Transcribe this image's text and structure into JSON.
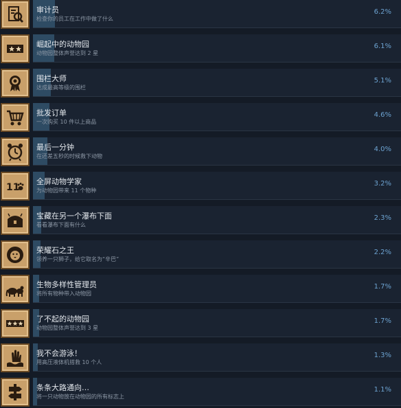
{
  "achievements": [
    {
      "title": "审计员",
      "desc": "检查你的员工在工作中做了什么",
      "percent": "6.2%",
      "fill": 0.062,
      "icon": "clipboard-search-icon"
    },
    {
      "title": "崛起中的动物园",
      "desc": "动物园整体声誉达到 2 星",
      "percent": "6.1%",
      "fill": 0.061,
      "icon": "two-stars-icon"
    },
    {
      "title": "围栏大师",
      "desc": "达成最高等级的围栏",
      "percent": "5.1%",
      "fill": 0.051,
      "icon": "award-ribbon-icon"
    },
    {
      "title": "批发订单",
      "desc": "一次购买 10 件以上商品",
      "percent": "4.6%",
      "fill": 0.046,
      "icon": "shopping-cart-icon"
    },
    {
      "title": "最后一分钟",
      "desc": "在还差五秒的时候救下动物",
      "percent": "4.0%",
      "fill": 0.04,
      "icon": "alarm-clock-icon"
    },
    {
      "title": "全屏动物学家",
      "desc": "为动物园带来 11 个物种",
      "percent": "3.2%",
      "fill": 0.032,
      "icon": "eleven-paw-icon"
    },
    {
      "title": "宝藏在另一个瀑布下面",
      "desc": "看看瀑布下面有什么",
      "percent": "2.3%",
      "fill": 0.023,
      "icon": "treasure-chest-icon"
    },
    {
      "title": "荣耀石之王",
      "desc": "领养一只狮子，给它取名为“辛巴”",
      "percent": "2.2%",
      "fill": 0.022,
      "icon": "lion-icon"
    },
    {
      "title": "生物多样性管理员",
      "desc": "将所有物种带入动物园",
      "percent": "1.7%",
      "fill": 0.017,
      "icon": "animals-icon"
    },
    {
      "title": "了不起的动物园",
      "desc": "动物园整体声誉达到 3 星",
      "percent": "1.7%",
      "fill": 0.017,
      "icon": "three-stars-icon"
    },
    {
      "title": "我不会游泳！",
      "desc": "用高压液体机搭救 10 个人",
      "percent": "1.3%",
      "fill": 0.013,
      "icon": "drowning-hand-icon"
    },
    {
      "title": "条条大路通向…",
      "desc": "将一只动物放在动物园的所有标志上",
      "percent": "1.1%",
      "fill": 0.011,
      "icon": "signpost-icon"
    }
  ]
}
